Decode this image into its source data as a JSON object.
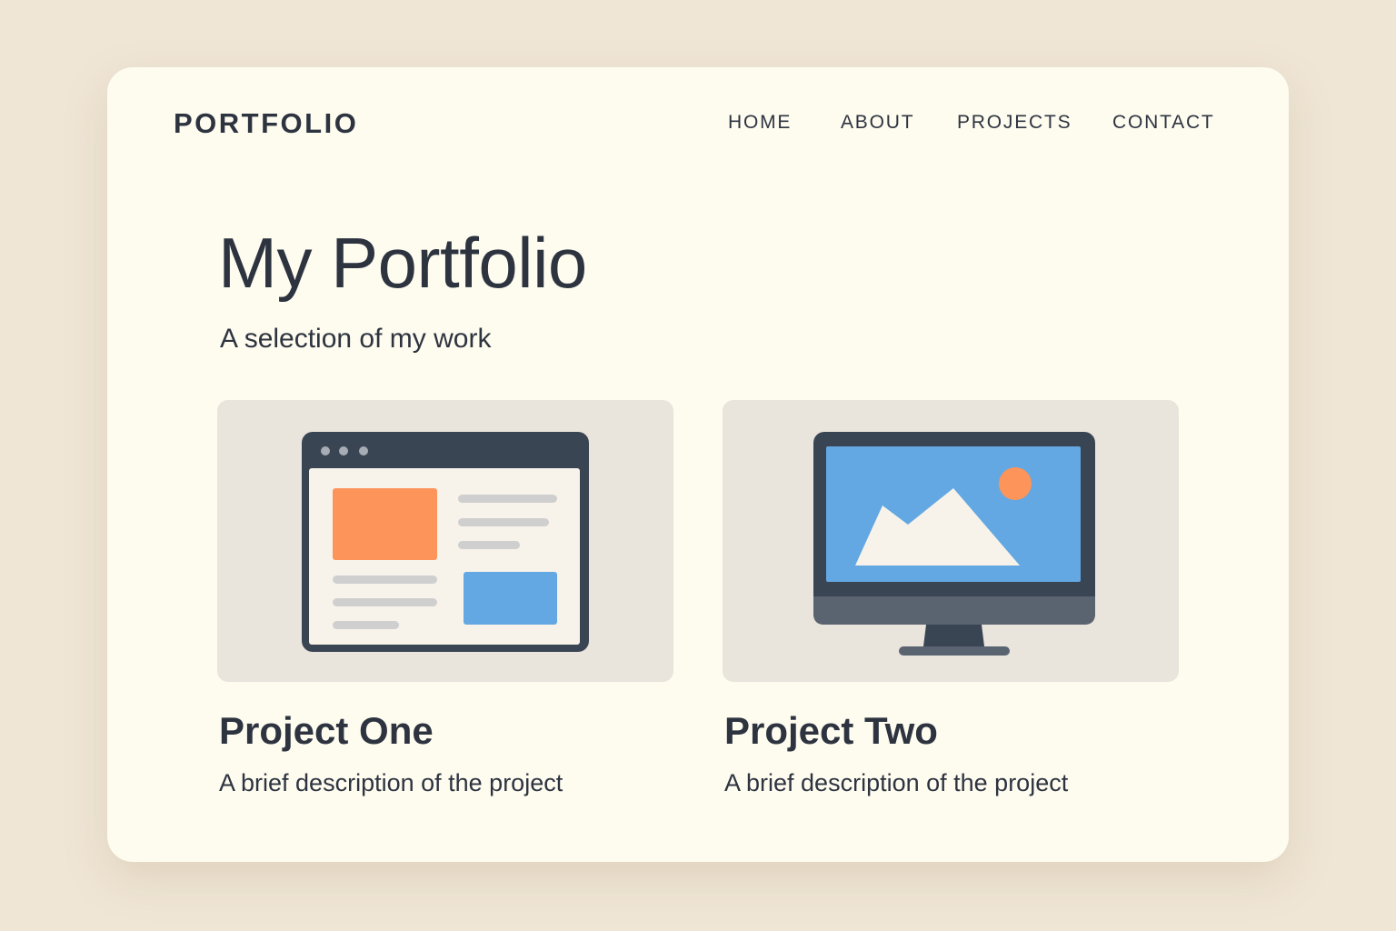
{
  "header": {
    "brand": "PORTFOLIO",
    "nav": [
      {
        "label": "HOME"
      },
      {
        "label": "ABOUT"
      },
      {
        "label": "PROJECTS"
      },
      {
        "label": "CONTACT"
      }
    ]
  },
  "hero": {
    "title": "My Portfolio",
    "subtitle": "A selection of my work"
  },
  "projects": [
    {
      "title": "Project One",
      "description": "A brief description of the project",
      "thumbnail_icon": "browser-window-icon"
    },
    {
      "title": "Project Two",
      "description": "A brief description of the project",
      "thumbnail_icon": "monitor-landscape-icon"
    }
  ],
  "colors": {
    "page_background": "#f0e6d6",
    "card_background": "#fefbef",
    "text": "#2d3440",
    "thumbnail_background": "#e9e4dc",
    "accent_orange": "#fd945a",
    "accent_blue": "#63a8e2"
  }
}
